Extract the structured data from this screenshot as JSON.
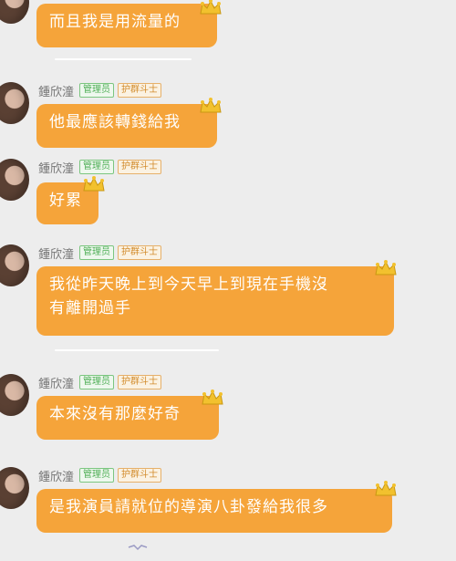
{
  "colors": {
    "background": "#ededed",
    "bubble": "#f5a43a",
    "bubble_text": "#ffffff",
    "admin_badge": "#4fae56",
    "guard_badge": "#d28b2b"
  },
  "messages": [
    {
      "sender": "",
      "text": "而且我是用流量的"
    },
    {
      "sender": "鍾欣潼",
      "badges": [
        "管理员",
        "护群斗士"
      ],
      "text": "他最應該轉錢給我"
    },
    {
      "sender": "鍾欣潼",
      "badges": [
        "管理员",
        "护群斗士"
      ],
      "text": "好累"
    },
    {
      "sender": "鍾欣潼",
      "badges": [
        "管理员",
        "护群斗士"
      ],
      "text_line1": "我從昨天晚上到今天早上到現在手機沒",
      "text_line2": "有離開過手"
    },
    {
      "sender": "鍾欣潼",
      "badges": [
        "管理员",
        "护群斗士"
      ],
      "text": "本來沒有那麼好奇"
    },
    {
      "sender": "鍾欣潼",
      "badges": [
        "管理员",
        "护群斗士"
      ],
      "text": "是我演員請就位的導演八卦發給我很多"
    }
  ],
  "icons": {
    "avatar": "avatar-photo",
    "crown": "crown-icon"
  }
}
